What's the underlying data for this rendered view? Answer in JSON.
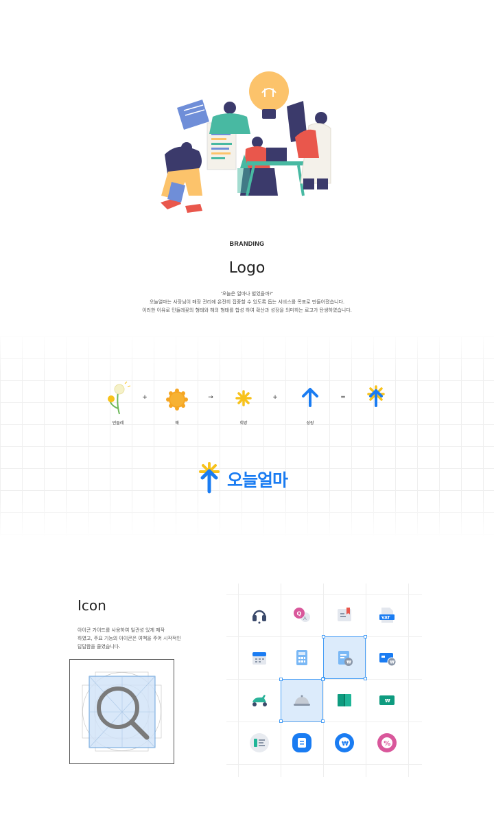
{
  "header": {
    "eyebrow": "BRANDING",
    "title": "Logo",
    "description": [
      "'오늘은 얼마나 벌었을까?'",
      "오늘얼마는 사장님이 매장 관리에 온전히 집중할 수 있도록 돕는 서비스를 목표로 만들어졌습니다.",
      "이러한 이유로 민들레꽃의 형태와 해의 형태를 합성 하여 확산과 성장을 의미하는 로고가 탄생하였습니다."
    ]
  },
  "formula": {
    "items": [
      {
        "label": "민들레",
        "icon": "dandelion-icon"
      },
      {
        "label": "해",
        "icon": "sun-icon"
      },
      {
        "label": "희망",
        "icon": "spark-icon"
      },
      {
        "label": "성장",
        "icon": "arrow-up-icon"
      },
      {
        "label": "",
        "icon": "logo-symbol-icon"
      }
    ],
    "operators": [
      "+",
      "→",
      "+",
      "="
    ]
  },
  "logo": {
    "wordmark": "오늘얼마",
    "brand_color": "#1a7cf2",
    "accent_color": "#f7c21b"
  },
  "icon_section": {
    "title": "Icon",
    "description": [
      "아이콘 가이드를 사용하여 일관성 있게 제작",
      "하였고, 주요 기능의 아이콘은 여백을 주어 시작적인",
      "답답함을 줄였습니다."
    ],
    "guide_icon": "search-icon",
    "grid_icons": [
      "headset-icon",
      "qa-chat-icon",
      "bookmark-note-icon",
      "vat-document-icon",
      "calendar-icon",
      "calculator-icon",
      "won-document-icon",
      "card-won-icon",
      "scooter-icon",
      "cloche-icon",
      "book-icon",
      "won-banknote-icon",
      "receipt-icon",
      "message-icon",
      "won-coin-icon",
      "percent-icon"
    ],
    "selected_cells": [
      6,
      9
    ]
  }
}
